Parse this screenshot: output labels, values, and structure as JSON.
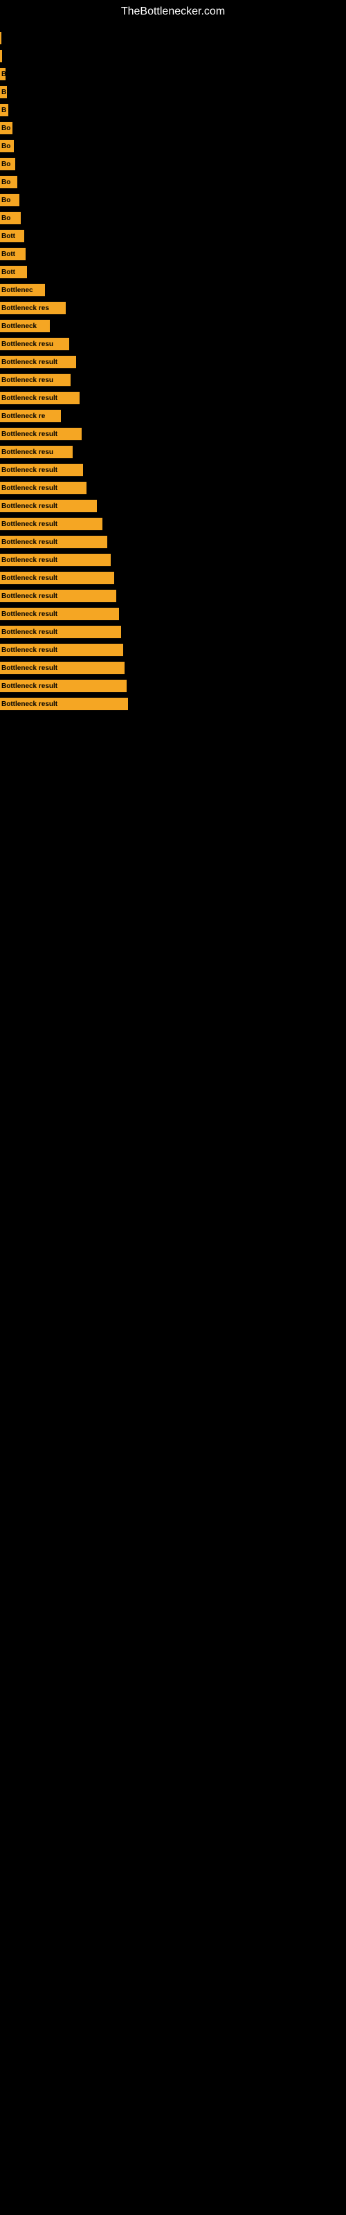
{
  "site": {
    "title": "TheBottlenecker.com"
  },
  "bars": [
    {
      "label": "",
      "width": 2
    },
    {
      "label": "",
      "width": 3
    },
    {
      "label": "B",
      "width": 8
    },
    {
      "label": "B",
      "width": 10
    },
    {
      "label": "B",
      "width": 12
    },
    {
      "label": "Bo",
      "width": 18
    },
    {
      "label": "Bo",
      "width": 20
    },
    {
      "label": "Bo",
      "width": 22
    },
    {
      "label": "Bo",
      "width": 25
    },
    {
      "label": "Bo",
      "width": 28
    },
    {
      "label": "Bo",
      "width": 30
    },
    {
      "label": "Bott",
      "width": 35
    },
    {
      "label": "Bott",
      "width": 37
    },
    {
      "label": "Bott",
      "width": 39
    },
    {
      "label": "Bottlenec",
      "width": 65
    },
    {
      "label": "Bottleneck res",
      "width": 95
    },
    {
      "label": "Bottleneck",
      "width": 72
    },
    {
      "label": "Bottleneck resu",
      "width": 100
    },
    {
      "label": "Bottleneck result",
      "width": 110
    },
    {
      "label": "Bottleneck resu",
      "width": 102
    },
    {
      "label": "Bottleneck result",
      "width": 115
    },
    {
      "label": "Bottleneck re",
      "width": 88
    },
    {
      "label": "Bottleneck result",
      "width": 118
    },
    {
      "label": "Bottleneck resu",
      "width": 105
    },
    {
      "label": "Bottleneck result",
      "width": 120
    },
    {
      "label": "Bottleneck result",
      "width": 125
    },
    {
      "label": "Bottleneck result",
      "width": 140
    },
    {
      "label": "Bottleneck result",
      "width": 148
    },
    {
      "label": "Bottleneck result",
      "width": 155
    },
    {
      "label": "Bottleneck result",
      "width": 160
    },
    {
      "label": "Bottleneck result",
      "width": 165
    },
    {
      "label": "Bottleneck result",
      "width": 168
    },
    {
      "label": "Bottleneck result",
      "width": 172
    },
    {
      "label": "Bottleneck result",
      "width": 175
    },
    {
      "label": "Bottleneck result",
      "width": 178
    },
    {
      "label": "Bottleneck result",
      "width": 180
    },
    {
      "label": "Bottleneck result",
      "width": 183
    },
    {
      "label": "Bottleneck result",
      "width": 185
    }
  ]
}
